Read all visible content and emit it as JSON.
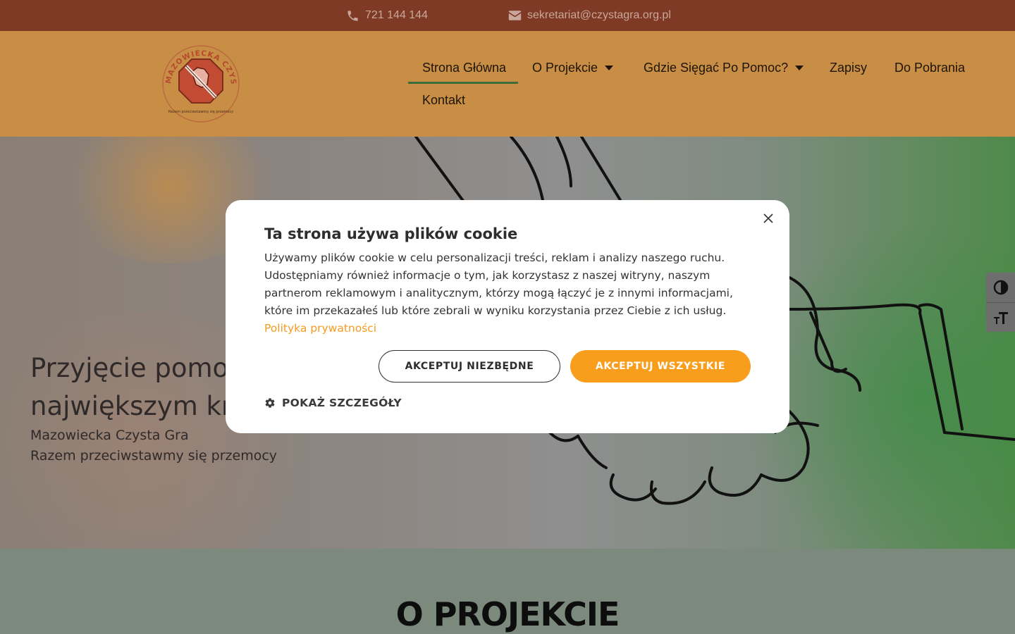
{
  "topbar": {
    "phone": "721 144 144",
    "email": "sekretariat@czystagra.org.pl",
    "phone_icon": "phone-icon",
    "email_icon": "envelope-icon"
  },
  "logo": {
    "arc_text": "MAZOWIECKA CZYSTA GRA",
    "tagline": "Razem przeciwstawmy się przemocy"
  },
  "nav": {
    "items": [
      {
        "label": "Strona Główna",
        "active": true
      },
      {
        "label": "O Projekcie",
        "has_dropdown": true
      },
      {
        "label": "Gdzie Sięgać Po Pomoc?",
        "has_dropdown": true
      },
      {
        "label": "Zapisy"
      },
      {
        "label": "Do Pobrania"
      },
      {
        "label": "Kontakt"
      }
    ]
  },
  "hero": {
    "title_line1": "Przyjęcie pomoc",
    "title_line2": "największym kro",
    "subtitle1": "Mazowiecka Czysta Gra",
    "subtitle2": "Razem przeciwstawmy się przemocy"
  },
  "accessibility": {
    "contrast_icon": "contrast-icon",
    "font_size_icon": "font-size-icon"
  },
  "section": {
    "title": "O PROJEKCIE"
  },
  "cookie": {
    "title": "Ta strona używa plików cookie",
    "body": "Używamy plików cookie w celu personalizacji treści, reklam i analizy naszego ruchu. Udostępniamy również informacje o tym, jak korzystasz z naszej witryny, naszym partnerom reklamowym i analitycznym, którzy mogą łączyć je z innymi informacjami, które im przekazałeś lub które zebrali w wyniku korzystania przez Ciebie z ich usług.",
    "privacy_link": "Polityka prywatności",
    "accept_necessary": "AKCEPTUJ NIEZBĘDNE",
    "accept_all": "AKCEPTUJ WSZYSTKIE",
    "show_details": "POKAŻ SZCZEGÓŁY",
    "close_icon": "close-icon",
    "gear_icon": "gear-icon",
    "accent_color": "#f99d1c"
  },
  "colors": {
    "topbar": "#7e3a24",
    "header": "#c98e46",
    "active_underline": "#3e6b3a"
  }
}
